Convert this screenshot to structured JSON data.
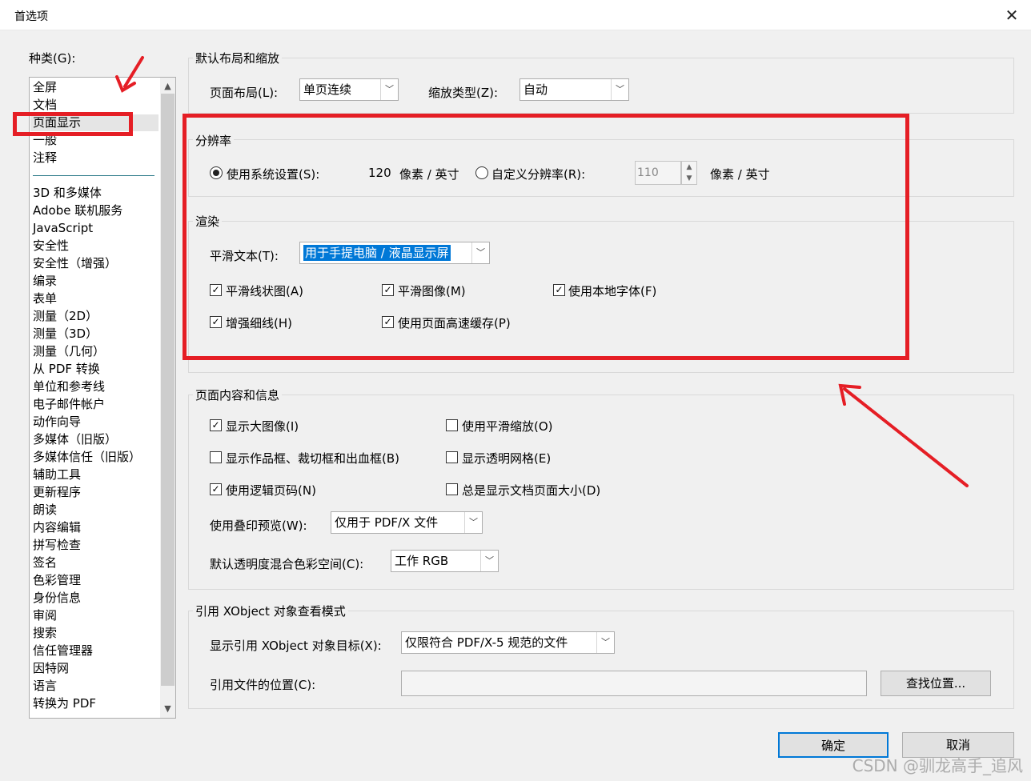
{
  "window": {
    "title": "首选项",
    "close_glyph": "✕"
  },
  "categories": {
    "label": "种类(G):",
    "items_top": [
      "全屏",
      "文档",
      "页面显示",
      "一般",
      "注释"
    ],
    "items": [
      "3D 和多媒体",
      "Adobe 联机服务",
      "JavaScript",
      "安全性",
      "安全性（增强）",
      "编录",
      "表单",
      "测量（2D）",
      "测量（3D）",
      "测量（几何）",
      "从 PDF 转换",
      "单位和参考线",
      "电子邮件帐户",
      "动作向导",
      "多媒体（旧版）",
      "多媒体信任（旧版）",
      "辅助工具",
      "更新程序",
      "朗读",
      "内容编辑",
      "拼写检查",
      "签名",
      "色彩管理",
      "身份信息",
      "审阅",
      "搜索",
      "信任管理器",
      "因特网",
      "语言",
      "转换为 PDF"
    ],
    "selected": "页面显示"
  },
  "layout": {
    "title": "默认布局和缩放",
    "page_layout_label": "页面布局(L):",
    "page_layout_value": "单页连续",
    "zoom_label": "缩放类型(Z):",
    "zoom_value": "自动"
  },
  "resolution": {
    "title": "分辨率",
    "system_label": "使用系统设置(S):",
    "system_value": "120",
    "unit1": "像素 / 英寸",
    "custom_label": "自定义分辨率(R):",
    "custom_value": "110",
    "unit2": "像素 / 英寸"
  },
  "rendering": {
    "title": "渲染",
    "smooth_text_label": "平滑文本(T):",
    "smooth_text_value": "用于手提电脑 / 液晶显示屏",
    "smooth_lineart": "平滑线状图(A)",
    "smooth_images": "平滑图像(M)",
    "local_fonts": "使用本地字体(F)",
    "enhance_thin": "增强细线(H)",
    "page_cache": "使用页面高速缓存(P)"
  },
  "page_content": {
    "title": "页面内容和信息",
    "show_large_images": "显示大图像(I)",
    "smooth_zoom": "使用平滑缩放(O)",
    "show_art_boxes": "显示作品框、裁切框和出血框(B)",
    "show_transparency_grid": "显示透明网格(E)",
    "logical_page_numbers": "使用逻辑页码(N)",
    "always_show_page_size": "总是显示文档页面大小(D)",
    "overprint_label": "使用叠印预览(W):",
    "overprint_value": "仅用于 PDF/X 文件",
    "blend_label": "默认透明度混合色彩空间(C):",
    "blend_value": "工作 RGB"
  },
  "xobject": {
    "title": "引用 XObject 对象查看模式",
    "target_label": "显示引用 XObject 对象目标(X):",
    "target_value": "仅限符合 PDF/X-5 规范的文件",
    "location_label": "引用文件的位置(C):",
    "find_button": "查找位置..."
  },
  "buttons": {
    "ok": "确定",
    "cancel": "取消"
  },
  "watermark": "CSDN @驯龙高手_追风",
  "colors": {
    "annotation_red": "#e51e25",
    "selection_blue": "#0078d7"
  }
}
